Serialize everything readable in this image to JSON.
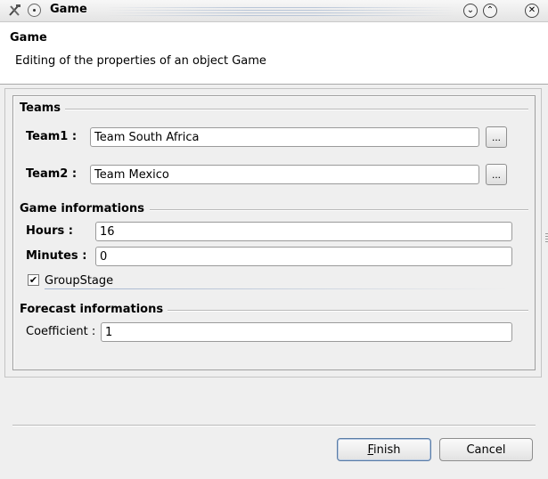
{
  "window": {
    "title": "Game",
    "app_icon": "tools-icon",
    "menu_icon": "circle-menu-icon",
    "minimize_glyph": "⌄",
    "maximize_glyph": "⌃",
    "close_glyph": "✕"
  },
  "header": {
    "title": "Game",
    "description": "Editing of the properties of an object Game"
  },
  "teams": {
    "section_title": "Teams",
    "team1_label": "Team1 :",
    "team1_value": "Team South Africa",
    "team2_label": "Team2 :",
    "team2_value": "Team Mexico",
    "browse_label": "..."
  },
  "game_info": {
    "section_title": "Game informations",
    "hours_label": "Hours :",
    "hours_value": "16",
    "minutes_label": "Minutes :",
    "minutes_value": "0",
    "groupstage_label": "GroupStage",
    "groupstage_checked": true,
    "check_glyph": "✔"
  },
  "forecast": {
    "section_title": "Forecast informations",
    "coefficient_label": "Coefficient :",
    "coefficient_value": "1"
  },
  "buttons": {
    "finish": "Finish",
    "cancel": "Cancel"
  }
}
